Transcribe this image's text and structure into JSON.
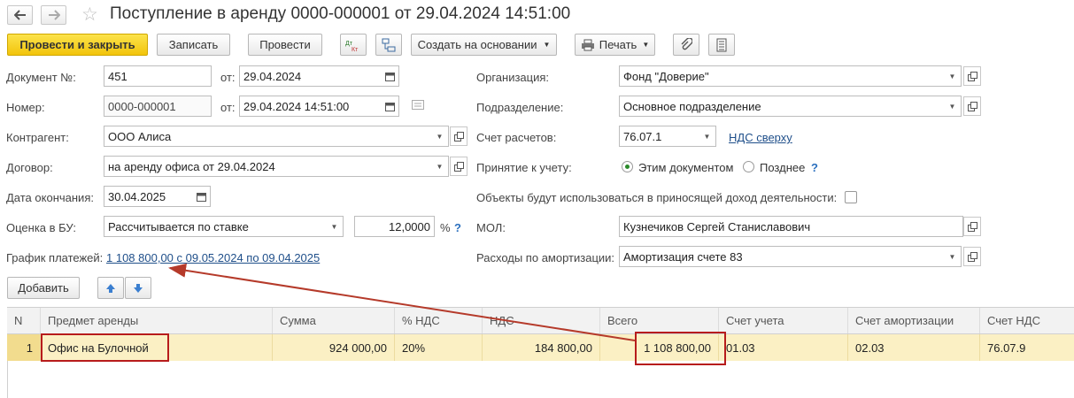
{
  "window": {
    "title": "Поступление в аренду 0000-000001 от 29.04.2024 14:51:00"
  },
  "toolbar": {
    "post_close": "Провести и закрыть",
    "save": "Записать",
    "post": "Провести",
    "dtkt": "Дт Кт",
    "create_based": "Создать на основании",
    "print": "Печать"
  },
  "form": {
    "doc_no_label": "Документ №:",
    "doc_no_value": "451",
    "from_label": "от:",
    "doc_date": "29.04.2024",
    "number_label": "Номер:",
    "number_value": "0000-000001",
    "number_date": "29.04.2024 14:51:00",
    "counterparty_label": "Контрагент:",
    "counterparty_value": "ООО Алиса",
    "contract_label": "Договор:",
    "contract_value": "на аренду офиса от 29.04.2024",
    "end_date_label": "Дата окончания:",
    "end_date_value": "30.04.2025",
    "bu_label": "Оценка в БУ:",
    "bu_value": "Рассчитывается по ставке",
    "rate_value": "12,0000",
    "rate_unit": "%",
    "rate_help": "?",
    "schedule_label": "График платежей:",
    "schedule_link": "1 108 800,00 с 09.05.2024 по 09.04.2025",
    "org_label": "Организация:",
    "org_value": "Фонд \"Доверие\"",
    "dept_label": "Подразделение:",
    "dept_value": "Основное подразделение",
    "account_label": "Счет расчетов:",
    "account_value": "76.07.1",
    "vat_link": "НДС сверху",
    "acceptance_label": "Принятие к учету:",
    "acceptance_opt1": "Этим документом",
    "acceptance_opt2": "Позднее",
    "acceptance_help": "?",
    "income_label": "Объекты будут использоваться в приносящей доход деятельности:",
    "mol_label": "МОЛ:",
    "mol_value": "Кузнечиков Сергей Станиславович",
    "amort_label": "Расходы по амортизации:",
    "amort_value": "Амортизация счете 83"
  },
  "table_toolbar": {
    "add": "Добавить"
  },
  "table": {
    "headers": [
      "N",
      "Предмет аренды",
      "Сумма",
      "% НДС",
      "НДС",
      "Всего",
      "Счет учета",
      "Счет амортизации",
      "Счет НДС"
    ],
    "rows": [
      [
        "1",
        "Офис на Булочной",
        "924 000,00",
        "20%",
        "184 800,00",
        "1 108 800,00",
        "01.03",
        "02.03",
        "76.07.9"
      ]
    ]
  },
  "colors": {
    "primary_button": "#f5cc1b",
    "selected_row": "#fbf0c4",
    "annotation": "#b71c1c",
    "link": "#1f4f8a"
  }
}
